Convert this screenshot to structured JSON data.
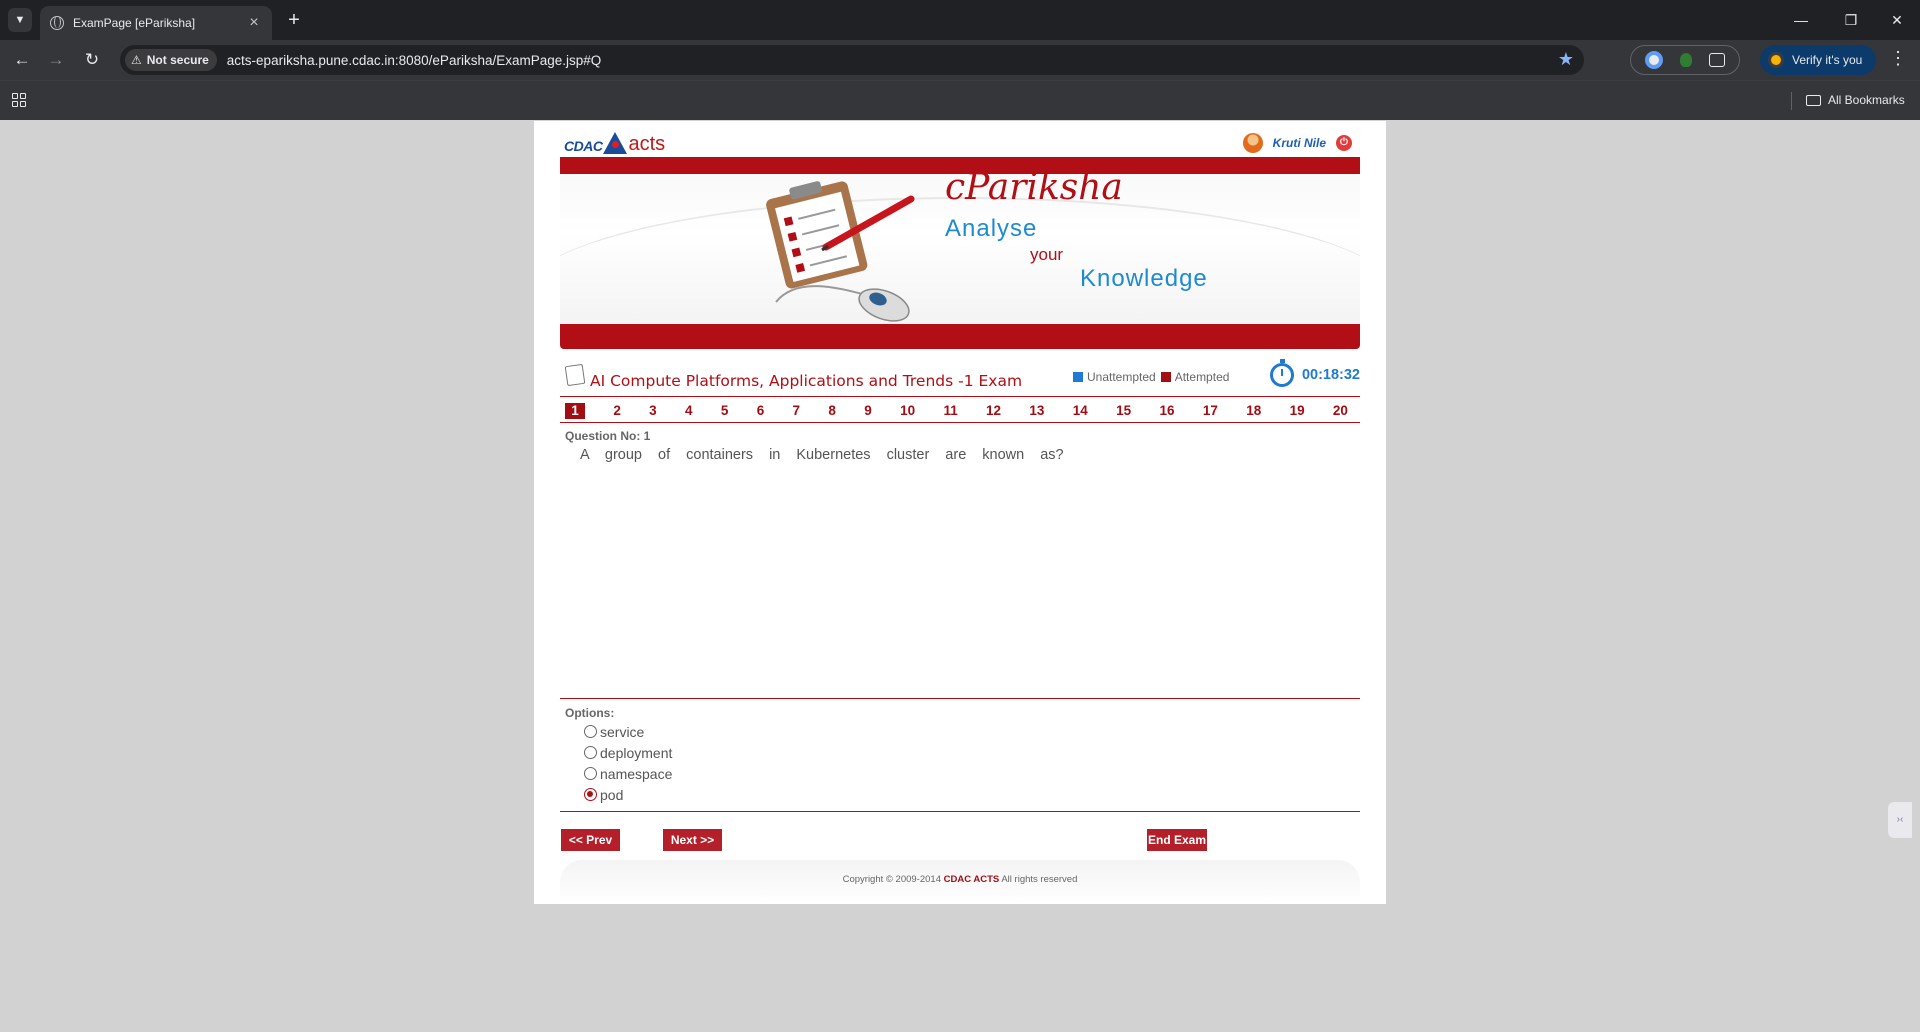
{
  "browser": {
    "tab_title": "ExamPage [ePariksha]",
    "new_tab": "+",
    "security_label": "Not secure",
    "url": "acts-epariksha.pune.cdac.in:8080/ePariksha/ExamPage.jsp#Q",
    "verify_label": "Verify it's you",
    "all_bookmarks": "All Bookmarks"
  },
  "header": {
    "logo_cdac": "CDAC",
    "logo_acts": "acts",
    "user_name": "Kruti Nile"
  },
  "banner": {
    "brand": "cPariksha",
    "tagline_1": "Analyse",
    "tagline_2": "your",
    "tagline_3": "Knowledge"
  },
  "exam": {
    "title": "AI Compute Platforms, Applications and Trends -1 Exam",
    "legend_unattempted": "Unattempted",
    "legend_attempted": "Attempted",
    "timer": "00:18:32",
    "colors": {
      "unattempted": "#1e7ad2",
      "attempted": "#a20d14"
    },
    "question_numbers": [
      "1",
      "2",
      "3",
      "4",
      "5",
      "6",
      "7",
      "8",
      "9",
      "10",
      "11",
      "12",
      "13",
      "14",
      "15",
      "16",
      "17",
      "18",
      "19",
      "20"
    ],
    "current_question": "1"
  },
  "question": {
    "number_label": "Question No: 1",
    "text": "A group of containers in Kubernetes cluster are known as?"
  },
  "options": {
    "label": "Options:",
    "items": [
      "service",
      "deployment",
      "namespace",
      "pod"
    ],
    "selected": "pod"
  },
  "buttons": {
    "prev": "<< Prev",
    "next": "Next >>",
    "end": "End Exam"
  },
  "footer": {
    "copyright": "Copyright © 2009-2014",
    "org": "CDAC ACTS",
    "rights": "All rights reserved"
  }
}
